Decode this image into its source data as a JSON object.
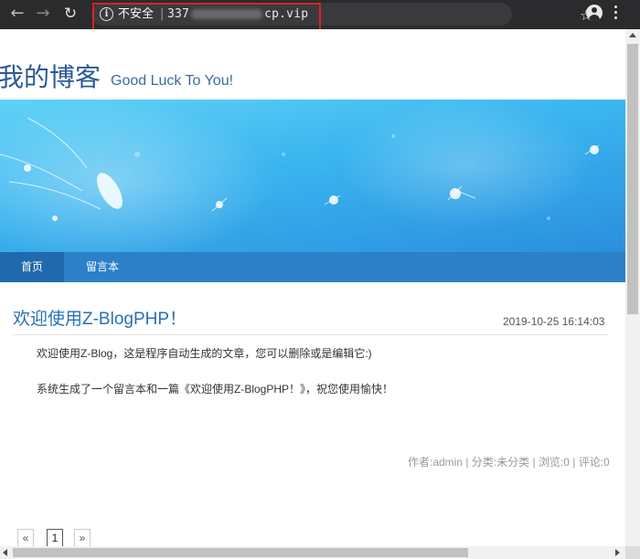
{
  "browser": {
    "security_label": "不安全",
    "separator": "|",
    "url_visible_start": "337",
    "url_visible_end": "cp.vip",
    "icons": {
      "back": "arrow-left-icon",
      "forward": "arrow-right-icon",
      "reload": "reload-icon",
      "info": "info-icon",
      "bookmark": "star-icon",
      "account": "account-icon",
      "menu": "kebab-menu-icon"
    },
    "highlight_color": "#e02020"
  },
  "site": {
    "title": "我的博客",
    "subtitle": "Good Luck To You!"
  },
  "nav": {
    "items": [
      {
        "label": "首页",
        "active": true
      },
      {
        "label": "留言本",
        "active": false
      }
    ]
  },
  "post": {
    "title": "欢迎使用Z-BlogPHP！",
    "date": "2019-10-25 16:14:03",
    "paragraphs": [
      "欢迎使用Z-Blog，这是程序自动生成的文章，您可以删除或是编辑它:)",
      "系统生成了一个留言本和一篇《欢迎使用Z-BlogPHP！》，祝您使用愉快！"
    ],
    "meta": "作者:admin | 分类:未分类 | 浏览:0 | 评论:0"
  },
  "pagination": {
    "prev": "«",
    "current": "1",
    "next": "»"
  },
  "colors": {
    "accent": "#2a6fb5",
    "nav_bar": "#2b80c8",
    "nav_active": "#2169ad",
    "toolbar": "#2b2b2d"
  }
}
